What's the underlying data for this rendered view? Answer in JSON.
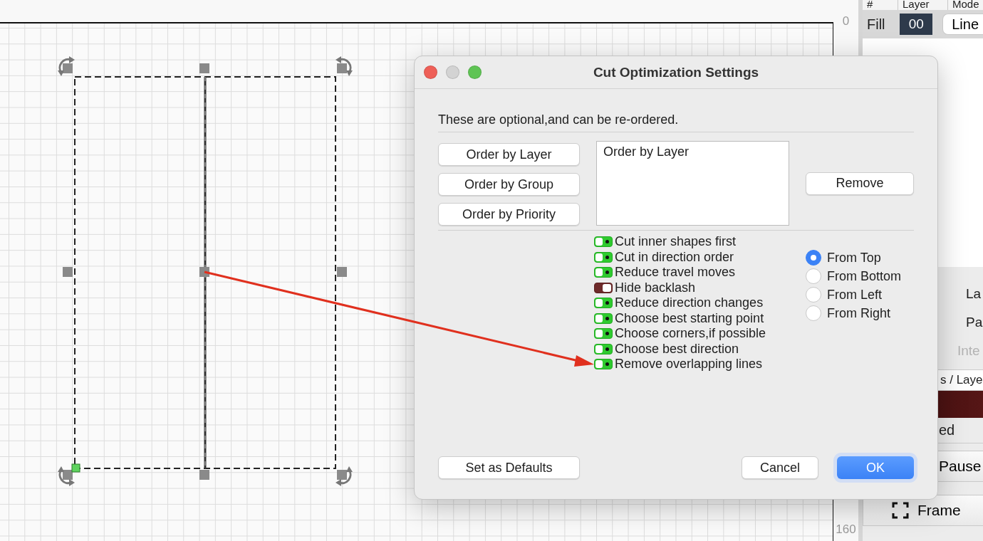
{
  "canvas": {
    "ruler_labels": [
      "0",
      "160"
    ]
  },
  "layers_panel": {
    "columns": [
      "#",
      "Layer",
      "Mode"
    ],
    "rows": [
      {
        "name": "Fill",
        "layer": "00",
        "mode": "Line"
      }
    ]
  },
  "side_panel": {
    "labels": [
      "La",
      "Pa"
    ],
    "disabled_label": "Inte",
    "header": "s / Laye",
    "status": "ed",
    "pause_button": "Pause",
    "frame_button": "Frame"
  },
  "dialog": {
    "title": "Cut Optimization Settings",
    "intro": "These are optional,and can be re-ordered.",
    "add_buttons": [
      "Order by Layer",
      "Order by Group",
      "Order by Priority"
    ],
    "order_list": [
      {
        "label": "Order by Layer",
        "selected": false
      }
    ],
    "remove_button": "Remove",
    "options": [
      {
        "label": "Cut inner shapes first",
        "on": true
      },
      {
        "label": "Cut in direction order",
        "on": true
      },
      {
        "label": "Reduce travel moves",
        "on": true
      },
      {
        "label": "Hide backlash",
        "on": false
      },
      {
        "label": "Reduce direction changes",
        "on": true
      },
      {
        "label": "Choose best starting point",
        "on": true
      },
      {
        "label": "Choose corners,if possible",
        "on": true
      },
      {
        "label": "Choose best direction",
        "on": true
      },
      {
        "label": "Remove overlapping lines",
        "on": true
      }
    ],
    "directions": [
      {
        "label": "From Top",
        "selected": true
      },
      {
        "label": "From Bottom",
        "selected": false
      },
      {
        "label": "From Left",
        "selected": false
      },
      {
        "label": "From Right",
        "selected": false
      }
    ],
    "defaults_button": "Set as Defaults",
    "cancel_button": "Cancel",
    "ok_button": "OK"
  }
}
